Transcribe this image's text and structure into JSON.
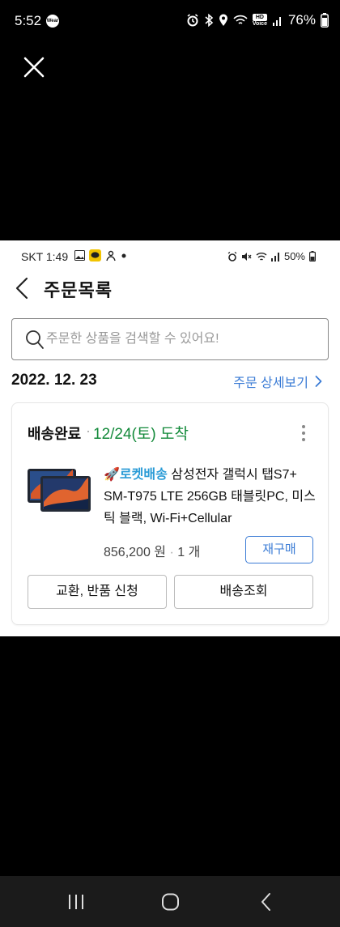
{
  "status_bar": {
    "time": "5:52",
    "wear_label": "Wear",
    "battery": "76%",
    "hd_label": "HD",
    "voice_label": "Voice"
  },
  "inner_status": {
    "carrier_time": "SKT 1:49",
    "battery": "50%"
  },
  "header": {
    "title": "주문목록"
  },
  "search": {
    "placeholder": "주문한 상품을 검색할 수 있어요!"
  },
  "order": {
    "date": "2022. 12. 23",
    "detail_link": "주문 상세보기",
    "status": "배송완료",
    "separator": "·",
    "arrival": "12/24(토) 도착",
    "rocket_label": "🚀로켓배송",
    "product_name": "삼성전자 갤럭시 탭S7+ SM-T975 LTE 256GB 태블릿PC, 미스틱 블랙, Wi-Fi+Cellular",
    "price": "856,200 원",
    "quantity": "1 개",
    "rebuy_label": "재구매",
    "exchange_label": "교환, 반품 신청",
    "tracking_label": "배송조회"
  },
  "colors": {
    "accent_blue": "#3a7bd5",
    "status_green": "#138a3a",
    "rocket_blue": "#2a9bd6"
  },
  "icons": [
    "close-icon",
    "back-chevron-icon",
    "search-icon",
    "chevron-right-icon",
    "more-vertical-icon",
    "recents-icon",
    "home-icon",
    "nav-back-icon"
  ]
}
